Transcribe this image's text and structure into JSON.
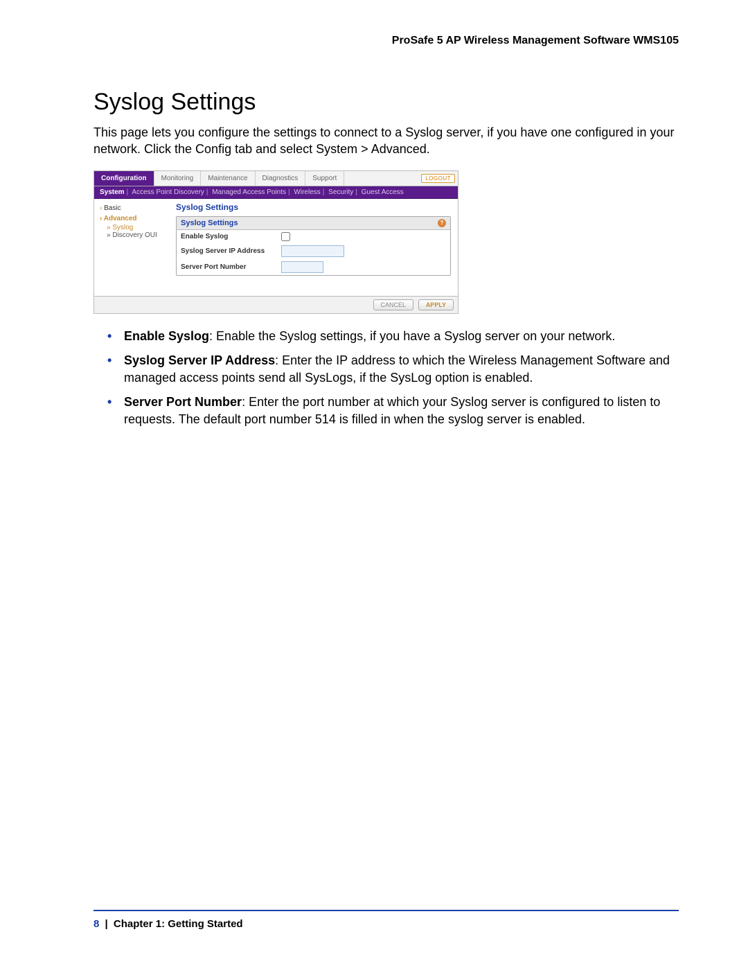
{
  "header": {
    "product": "ProSafe 5 AP Wireless Management Software WMS105"
  },
  "section": {
    "title": "Syslog Settings",
    "intro": "This page lets you configure the settings to connect to a Syslog server, if you have one configured in your network. Click the Config tab and select System > Advanced."
  },
  "screenshot": {
    "tabs": [
      "Configuration",
      "Monitoring",
      "Maintenance",
      "Diagnostics",
      "Support"
    ],
    "active_tab_index": 0,
    "logout": "LOGOUT",
    "subnav": [
      "System",
      "Access Point Discovery",
      "Managed Access Points",
      "Wireless",
      "Security",
      "Guest Access"
    ],
    "subnav_active_index": 0,
    "sidebar": {
      "basic": "Basic",
      "advanced": "Advanced",
      "syslog": "Syslog",
      "discovery": "Discovery OUI"
    },
    "panel": {
      "page_title": "Syslog Settings",
      "header": "Syslog Settings",
      "rows": {
        "enable_label": "Enable Syslog",
        "ip_label": "Syslog Server IP Address",
        "port_label": "Server Port Number"
      }
    },
    "buttons": {
      "cancel": "CANCEL",
      "apply": "APPLY"
    }
  },
  "bullets": [
    {
      "term": "Enable Syslog",
      "text": ": Enable the Syslog settings, if you have a Syslog server on your network."
    },
    {
      "term": "Syslog Server IP Address",
      "text": ": Enter the IP address to which the Wireless Management Software and managed access points send all SysLogs, if the SysLog option is enabled."
    },
    {
      "term": "Server Port Number",
      "text": ": Enter the port number at which your Syslog server is configured to listen to requests. The default port number 514 is filled in when the syslog server is enabled."
    }
  ],
  "footer": {
    "page": "8",
    "separator": "|",
    "chapter": "Chapter 1:  Getting Started"
  }
}
